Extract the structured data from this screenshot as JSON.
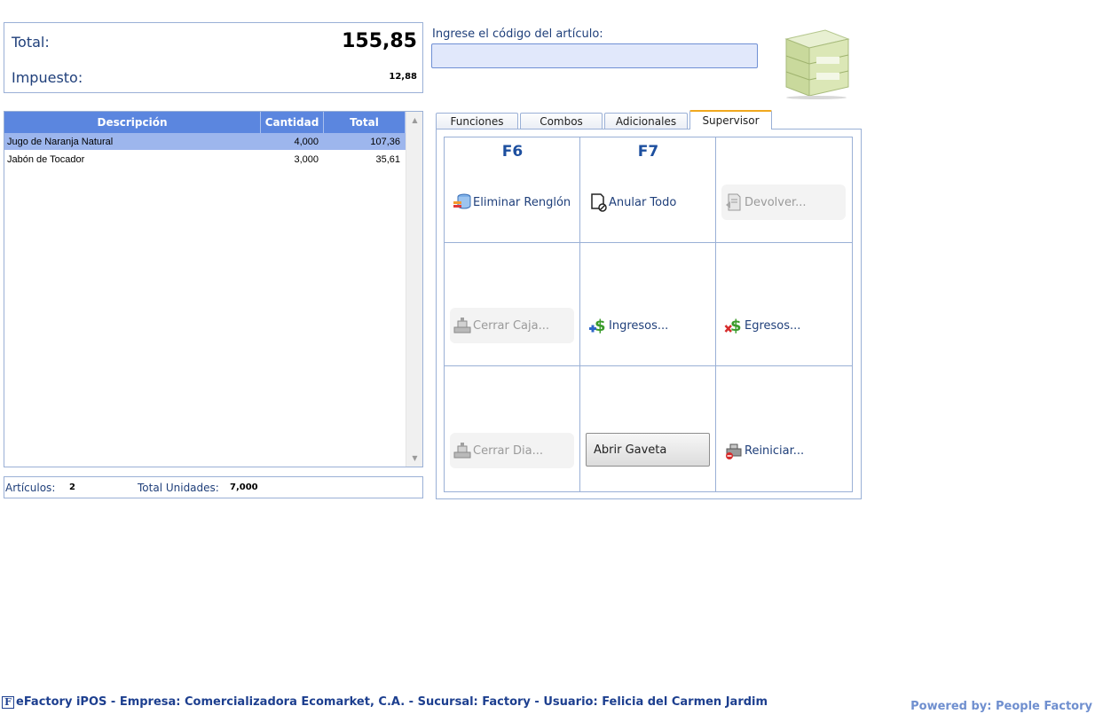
{
  "totals": {
    "total_label": "Total:",
    "total_value": "155,85",
    "tax_label": "Impuesto:",
    "tax_value": "12,88"
  },
  "code_entry": {
    "label": "Ingrese el código del artículo:",
    "value": ""
  },
  "grid": {
    "headers": [
      "Descripción",
      "Cantidad",
      "Total"
    ],
    "rows": [
      {
        "description": "Jugo de Naranja Natural",
        "quantity": "4,000",
        "total": "107,36",
        "selected": true
      },
      {
        "description": "Jabón de Tocador",
        "quantity": "3,000",
        "total": "35,61",
        "selected": false
      }
    ]
  },
  "summary": {
    "articles_label": "Artículos:",
    "articles_value": "2",
    "units_label": "Total Unidades:",
    "units_value": "7,000"
  },
  "tabs": {
    "items": [
      "Funciones",
      "Combos",
      "Adicionales",
      "Supervisor"
    ],
    "active": "Supervisor"
  },
  "functions": {
    "f6": "F6",
    "f7": "F7",
    "eliminar_renglon": "Eliminar Renglón",
    "anular_todo": "Anular Todo",
    "devolver": "Devolver...",
    "cerrar_caja": "Cerrar Caja...",
    "ingresos": "Ingresos...",
    "egresos": "Egresos...",
    "cerrar_dia": "Cerrar Dia...",
    "abrir_gaveta": "Abrir Gaveta",
    "reiniciar": "Reiniciar..."
  },
  "footer": {
    "logo_letter": "F",
    "status": "eFactory iPOS - Empresa: Comercializadora Ecomarket, C.A. - Sucursal: Factory - Usuario: Felicia del Carmen Jardim",
    "powered_by": "Powered by: People Factory"
  },
  "colors": {
    "grid_header": "#5b86df",
    "selected_row": "#9db6ed",
    "input_bg": "#e1e8fb",
    "active_tab_accent": "#f0a81e",
    "text_primary": "#1f3f7a"
  }
}
